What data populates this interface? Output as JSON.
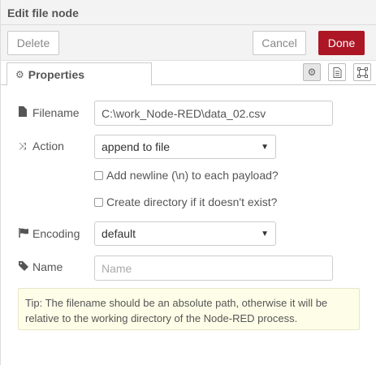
{
  "dialog": {
    "title": "Edit file node"
  },
  "toolbar": {
    "delete_label": "Delete",
    "cancel_label": "Cancel",
    "done_label": "Done"
  },
  "tabs": {
    "properties_label": "Properties",
    "icons": [
      "gear-icon",
      "description-icon",
      "appearance-icon"
    ]
  },
  "form": {
    "filename": {
      "label": "Filename",
      "value": "C:\\work_Node-RED\\data_02.csv",
      "icon": "file-icon"
    },
    "action": {
      "label": "Action",
      "value": "append to file",
      "icon": "shuffle-icon"
    },
    "add_newline": {
      "label": "Add newline (\\n) to each payload?",
      "checked": false
    },
    "create_dir": {
      "label": "Create directory if it doesn't exist?",
      "checked": false
    },
    "encoding": {
      "label": "Encoding",
      "value": "default",
      "icon": "flag-icon"
    },
    "name": {
      "label": "Name",
      "value": "",
      "placeholder": "Name",
      "icon": "tag-icon"
    }
  },
  "tip": {
    "text": "Tip: The filename should be an absolute path, otherwise it will be relative to the working directory of the Node-RED process."
  },
  "colors": {
    "done_button": "#ad1625",
    "tip_background": "#fefee8"
  }
}
